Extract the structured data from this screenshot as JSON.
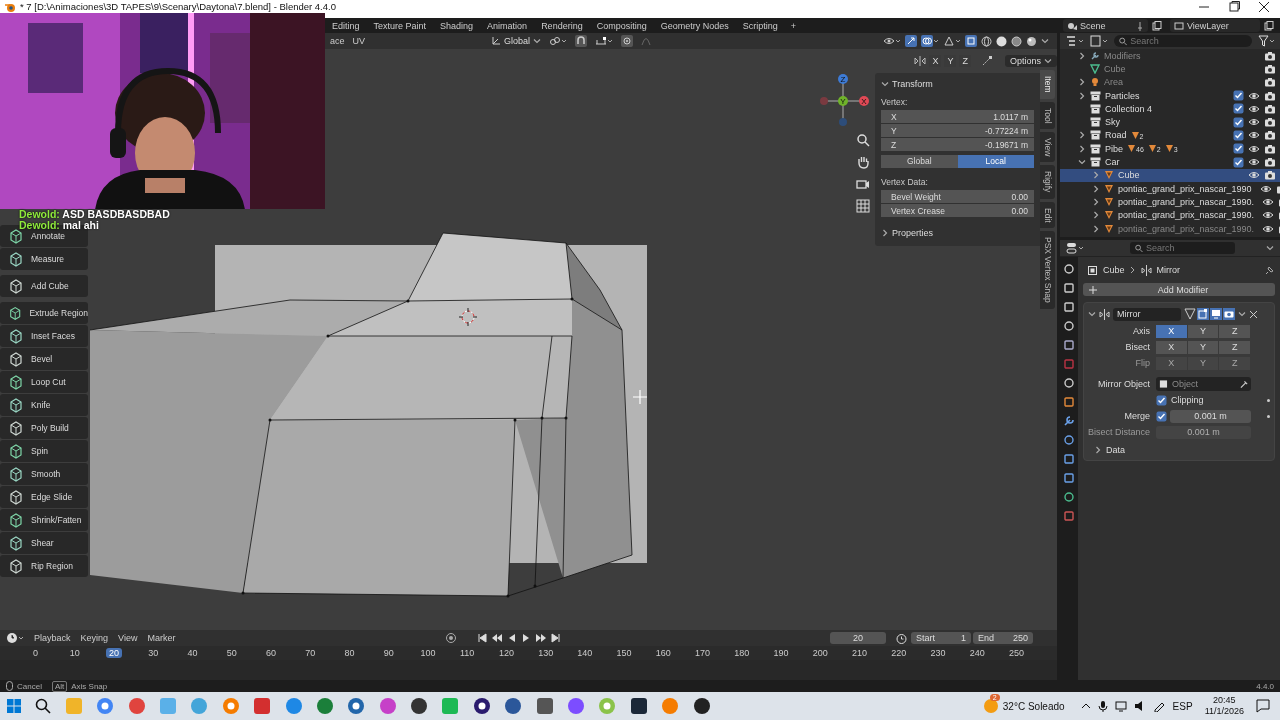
{
  "window": {
    "title": "* 7 [D:\\Animaciones\\3D TAPES\\9\\Scenary\\Daytona\\7.blend] - Blender 4.4.0"
  },
  "workspaces": [
    {
      "label": "Editing",
      "selected": false
    },
    {
      "label": "Texture Paint",
      "selected": false
    },
    {
      "label": "Shading",
      "selected": false
    },
    {
      "label": "Animation",
      "selected": false
    },
    {
      "label": "Rendering",
      "selected": false
    },
    {
      "label": "Compositing",
      "selected": false
    },
    {
      "label": "Geometry Nodes",
      "selected": false
    },
    {
      "label": "Scripting",
      "selected": false
    }
  ],
  "add_workspace": "+",
  "scene": "Scene",
  "view_layer": "ViewLayer",
  "header": {
    "menus": [
      "ace",
      "UV"
    ],
    "orientation": "Global"
  },
  "snap_axes": [
    "X",
    "Y",
    "Z"
  ],
  "options": "Options",
  "gizmo_axes": [
    "X",
    "Y",
    "Z"
  ],
  "chat": [
    {
      "user": "Dewold:",
      "message": "ASD BASDBASDBAD"
    },
    {
      "user": "Dewold:",
      "message": "mal ahi"
    }
  ],
  "toolbar": {
    "groups": [
      [
        "Annotate",
        "Measure"
      ],
      [
        "Add Cube"
      ],
      [
        "Extrude Region",
        "Inset Faces",
        "Bevel",
        "Loop Cut",
        "Knife",
        "Poly Build",
        "Spin",
        "Smooth",
        "Edge Slide",
        "Shrink/Fatten",
        "Shear",
        "Rip Region"
      ]
    ]
  },
  "transform": {
    "title": "Transform",
    "expanded": true,
    "vertex_label": "Vertex:",
    "fields": [
      {
        "axis": "X",
        "value": "1.0117 m"
      },
      {
        "axis": "Y",
        "value": "-0.77224 m"
      },
      {
        "axis": "Z",
        "value": "-0.19671 m"
      }
    ],
    "spaces": [
      {
        "label": "Global",
        "selected": false
      },
      {
        "label": "Local",
        "selected": true
      }
    ],
    "vertex_data_label": "Vertex Data:",
    "data_fields": [
      {
        "label": "Bevel Weight",
        "value": "0.00"
      },
      {
        "label": "Vertex Crease",
        "value": "0.00"
      }
    ],
    "properties": {
      "label": "Properties",
      "expanded": false
    }
  },
  "viewport_tabs": [
    {
      "label": "Item",
      "selected": true
    },
    {
      "label": "Tool",
      "selected": false
    },
    {
      "label": "View",
      "selected": false
    },
    {
      "label": "Rigify",
      "selected": false
    },
    {
      "label": "Edit",
      "selected": false
    },
    {
      "label": "PSX Vertex Snap",
      "selected": false
    }
  ],
  "outliner": {
    "search": {
      "placeholder": "Search"
    },
    "rows": [
      {
        "name": "Modifiers",
        "kind": "modifiers",
        "expanded": false,
        "dimmed": true,
        "selected": false
      },
      {
        "name": "Cube",
        "kind": "mesh",
        "dimmed": true,
        "selected": false
      },
      {
        "name": "Area",
        "kind": "light",
        "expanded": false,
        "dimmed": true,
        "selected": false
      },
      {
        "name": "Particles",
        "kind": "collection",
        "expanded": false,
        "checked": true,
        "dimmed": false,
        "selected": false
      },
      {
        "name": "Collection 4",
        "kind": "collection",
        "checked": true,
        "dimmed": false,
        "selected": false
      },
      {
        "name": "Sky",
        "kind": "collection",
        "checked": true,
        "dimmed": false,
        "selected": false
      },
      {
        "name": "Road",
        "kind": "collection",
        "expanded": false,
        "checked": true,
        "dimmed": false,
        "selected": false,
        "counts": [
          "2"
        ]
      },
      {
        "name": "Pibe",
        "kind": "collection",
        "expanded": false,
        "checked": true,
        "dimmed": false,
        "selected": false,
        "counts": [
          "46",
          "2",
          "3"
        ]
      },
      {
        "name": "Car",
        "kind": "collection",
        "expanded": true,
        "checked": true,
        "dimmed": false,
        "selected": false,
        "children": [
          {
            "name": "Cube",
            "kind": "object",
            "expanded": false,
            "dimmed": false,
            "selected": true
          },
          {
            "name": "pontiac_grand_prix_nascar_1990",
            "kind": "object",
            "expanded": false,
            "dimmed": false,
            "selected": false
          },
          {
            "name": "pontiac_grand_prix_nascar_1990.",
            "kind": "object",
            "expanded": false,
            "dimmed": false,
            "selected": false
          },
          {
            "name": "pontiac_grand_prix_nascar_1990.",
            "kind": "object",
            "expanded": false,
            "dimmed": false,
            "selected": false
          },
          {
            "name": "pontiac_grand_prix_nascar_1990.",
            "kind": "object",
            "expanded": false,
            "dimmed": true,
            "selected": false
          }
        ]
      }
    ]
  },
  "properties": {
    "search": {
      "placeholder": "Search"
    },
    "breadcrumb": [
      "Cube",
      "Mirror"
    ],
    "add_modifier": "Add Modifier",
    "modifier": {
      "name": "Mirror",
      "expanded": true,
      "rows": [
        {
          "label": "Axis",
          "disabled": false,
          "options": [
            {
              "label": "X",
              "selected": true
            },
            {
              "label": "Y",
              "selected": false
            },
            {
              "label": "Z",
              "selected": false
            }
          ]
        },
        {
          "label": "Bisect",
          "disabled": false,
          "options": [
            {
              "label": "X",
              "selected": false
            },
            {
              "label": "Y",
              "selected": false
            },
            {
              "label": "Z",
              "selected": false
            }
          ]
        },
        {
          "label": "Flip",
          "disabled": true,
          "options": [
            {
              "label": "X",
              "selected": false
            },
            {
              "label": "Y",
              "selected": false
            },
            {
              "label": "Z",
              "selected": false
            }
          ]
        }
      ],
      "mirror_object": {
        "label": "Mirror Object",
        "placeholder": "Object"
      },
      "clipping": {
        "label": "Clipping",
        "checked": true
      },
      "merge": {
        "label": "Merge",
        "checked": true,
        "value": "0.001 m"
      },
      "bisect_distance": {
        "label": "Bisect Distance",
        "value": "0.001 m",
        "disabled": true
      },
      "data": {
        "label": "Data",
        "expanded": false
      }
    }
  },
  "timeline": {
    "menus": [
      "Playback",
      "Keying",
      "View",
      "Marker"
    ],
    "current_frame": "20",
    "start_label": "Start",
    "start": "1",
    "end_label": "End",
    "end": "250",
    "ruler": [
      {
        "label": "0",
        "selected": false
      },
      {
        "label": "10",
        "selected": false
      },
      {
        "label": "20",
        "selected": true
      },
      {
        "label": "30",
        "selected": false
      },
      {
        "label": "40",
        "selected": false
      },
      {
        "label": "50",
        "selected": false
      },
      {
        "label": "60",
        "selected": false
      },
      {
        "label": "70",
        "selected": false
      },
      {
        "label": "80",
        "selected": false
      },
      {
        "label": "90",
        "selected": false
      },
      {
        "label": "100",
        "selected": false
      },
      {
        "label": "110",
        "selected": false
      },
      {
        "label": "120",
        "selected": false
      },
      {
        "label": "130",
        "selected": false
      },
      {
        "label": "140",
        "selected": false
      },
      {
        "label": "150",
        "selected": false
      },
      {
        "label": "160",
        "selected": false
      },
      {
        "label": "170",
        "selected": false
      },
      {
        "label": "180",
        "selected": false
      },
      {
        "label": "190",
        "selected": false
      },
      {
        "label": "200",
        "selected": false
      },
      {
        "label": "210",
        "selected": false
      },
      {
        "label": "220",
        "selected": false
      },
      {
        "label": "230",
        "selected": false
      },
      {
        "label": "240",
        "selected": false
      },
      {
        "label": "250",
        "selected": false
      }
    ]
  },
  "status": {
    "cancel": "Cancel",
    "key": "Alt",
    "key_action": "Axis Snap",
    "version": "4.4.0"
  },
  "taskbar": {
    "weather_badge": "2",
    "weather": "32°C Soleado",
    "language": "ESP",
    "time": "20:45",
    "date": "11/1/2026"
  }
}
